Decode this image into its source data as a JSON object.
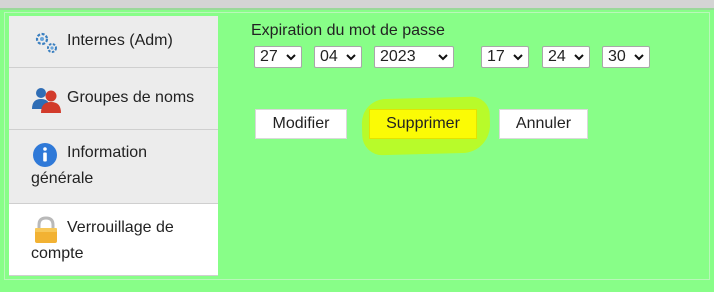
{
  "sidebar": {
    "items": [
      {
        "label": "Internes (Adm)",
        "icon": "gears-icon"
      },
      {
        "label": "Groupes de noms",
        "icon": "users-group-icon"
      },
      {
        "label": "Information générale",
        "icon": "info-icon"
      },
      {
        "label": "Verrouillage de compte",
        "icon": "padlock-icon",
        "active": true
      }
    ]
  },
  "main": {
    "title": "Expiration du mot de passe",
    "date": {
      "day": "27",
      "month": "04",
      "year": "2023"
    },
    "time": {
      "hour": "17",
      "minute": "24",
      "second": "30"
    },
    "buttons": {
      "modify": "Modifier",
      "delete": "Supprimer",
      "cancel": "Annuler"
    }
  },
  "colors": {
    "page_background": "#88fe88",
    "highlight_marker": "#b8fb2a",
    "delete_button": "#fbfb05",
    "active_tab": "#ffffff",
    "inactive_tab": "#ececec"
  }
}
